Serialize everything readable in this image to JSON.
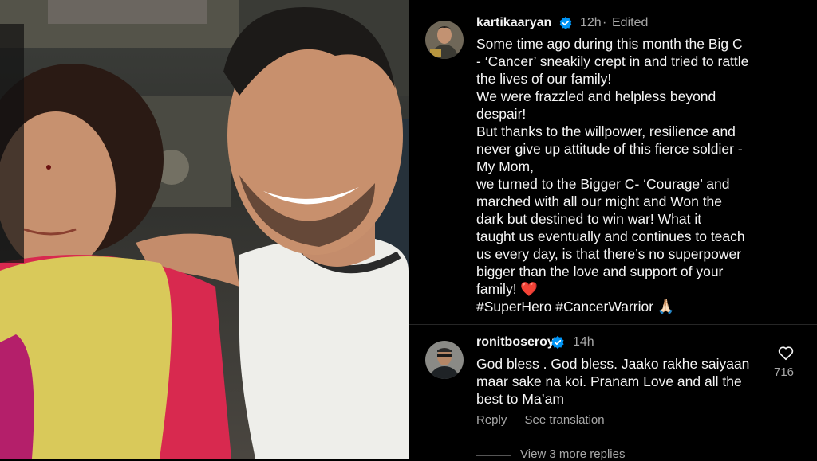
{
  "post": {
    "username": "kartikaaryan",
    "time": "12h",
    "edited": "Edited",
    "caption_lines": [
      "Some time ago during this month the Big C",
      "- ‘Cancer’ sneakily crept in and tried to rattle",
      "the lives of our family!",
      "We were frazzled and helpless beyond",
      "despair!",
      "But thanks to the willpower, resilience and",
      "never give up attitude of this fierce soldier -",
      "My Mom,",
      "we turned to the Bigger C- ‘Courage’ and",
      "marched with all our might and Won the",
      "dark but destined to win war!  What it",
      "taught us eventually and continues to teach",
      "us every day,  is that there’s no superpower",
      "bigger than the love and support of your",
      "family! ❤️",
      "#SuperHero #CancerWarrior 🙏🏻"
    ]
  },
  "comment": {
    "username": "ronitboseroy",
    "time": "14h",
    "lines": [
      "God bless . God bless. Jaako rakhe saiyaan",
      "maar sake na koi. Pranam Love and all the",
      "best to Ma’am"
    ],
    "reply_label": "Reply",
    "translate_label": "See translation",
    "likes": "716",
    "view_replies": "View 3 more replies"
  },
  "colors": {
    "verified": "#0095f6",
    "text": "#f5f5f5",
    "muted": "#a8a8a8"
  },
  "icons": {
    "verified": "verified-badge-icon",
    "like": "heart-outline-icon"
  }
}
